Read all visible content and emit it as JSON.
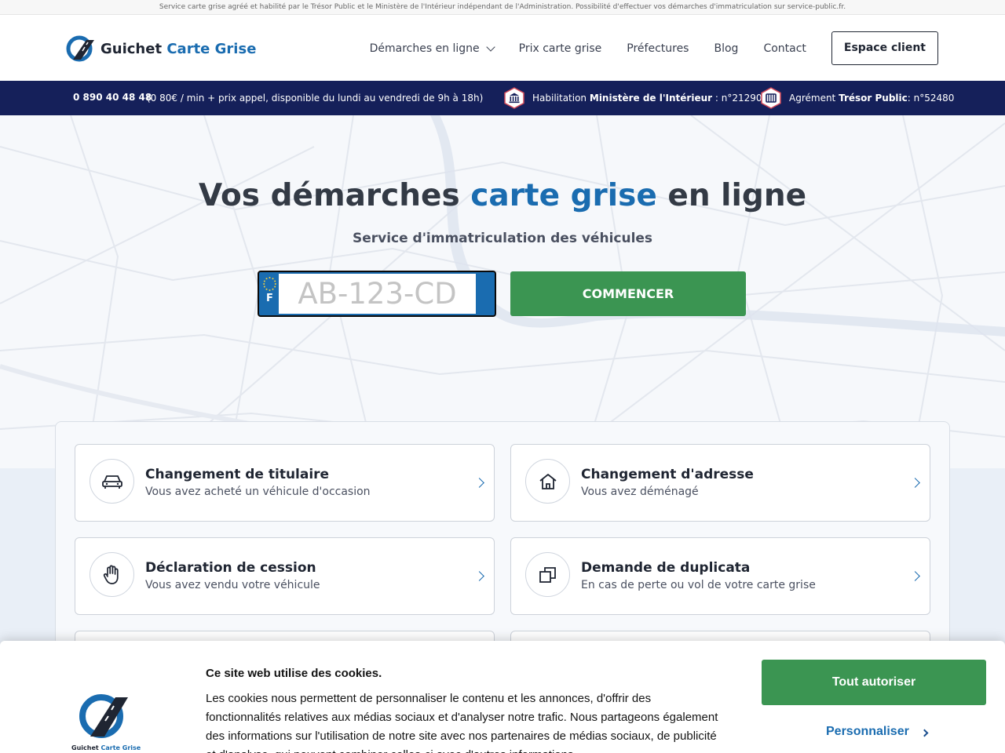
{
  "notice": "Service carte grise agréé et habilité par le Trésor Public et le Ministère de l'Intérieur indépendant de l'Administration. Possibilité d'effectuer vos démarches d'immatriculation sur service-public.fr.",
  "header": {
    "logo_primary": "Guichet",
    "logo_accent": "Carte Grise",
    "nav": [
      "Démarches en ligne",
      "Prix carte grise",
      "Préfectures",
      "Blog",
      "Contact"
    ],
    "espace_client": "Espace client"
  },
  "infobar": {
    "phone": "0 890 40 48 48",
    "phone_note": "(0 80€ / min + prix appel, disponible du lundi au vendredi de 9h à 18h)",
    "badge1_prefix": "Habilitation",
    "badge1_bold": "Ministère de l'Intérieur",
    "badge1_suffix": ": n°212900",
    "badge2_prefix": "Agrément",
    "badge2_bold": "Trésor Public",
    "badge2_suffix": ": n°52480"
  },
  "hero": {
    "title_part1": "Vos démarches",
    "title_accent": "carte grise",
    "title_part2": "en ligne",
    "subtitle": "Service d'immatriculation des véhicules",
    "plate_country": "F",
    "plate_placeholder": "AB-123-CD",
    "plate_value": "",
    "start_button": "COMMENCER"
  },
  "cards": [
    {
      "title": "Changement de titulaire",
      "desc": "Vous avez acheté un véhicule d'occasion",
      "icon": "car-icon"
    },
    {
      "title": "Changement d'adresse",
      "desc": "Vous avez déménagé",
      "icon": "house-icon"
    },
    {
      "title": "Déclaration de cession",
      "desc": "Vous avez vendu votre véhicule",
      "icon": "hand-icon"
    },
    {
      "title": "Demande de duplicata",
      "desc": "En cas de perte ou vol de votre carte grise",
      "icon": "duplicate-icon"
    }
  ],
  "cookie": {
    "title": "Ce site web utilise des cookies.",
    "text": "Les cookies nous permettent de personnaliser le contenu et les annonces, d'offrir des fonctionnalités relatives aux médias sociaux et d'analyser notre trafic. Nous partageons également des informations sur l'utilisation de notre site avec nos partenaires de médias sociaux, de publicité et d'analyse, qui peuvent combiner celles-ci avec d'autres informations",
    "allow_button": "Tout autoriser",
    "customize_button": "Personnaliser",
    "logo_primary": "Guichet",
    "logo_accent": "Carte Grise"
  },
  "colors": {
    "brand_blue": "#1a6cb0",
    "navy": "#15205a",
    "green": "#3b9552"
  }
}
